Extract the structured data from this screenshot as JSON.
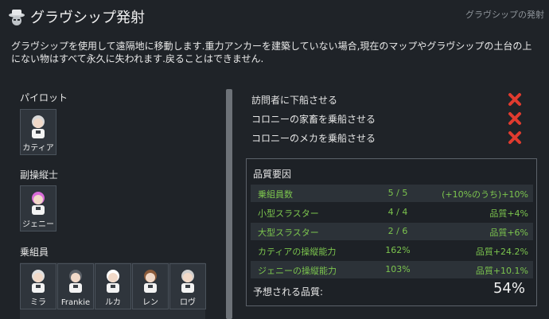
{
  "header": {
    "title": "グラヴシップ発射",
    "subtitle": "グラヴシップの発射"
  },
  "description": "グラヴシップを使用して遠隔地に移動します.重力アンカーを建築していない場合,現在のマップやグラヴシップの土台の上にない物はすべて永久に失われます.戻ることはできません.",
  "pilot": {
    "label": "パイロット",
    "members": [
      {
        "name": "カティア",
        "hair": "#d9d9d9"
      }
    ]
  },
  "copilot": {
    "label": "副操縦士",
    "members": [
      {
        "name": "ジェニー",
        "hair": "#d86bd8"
      }
    ]
  },
  "crew": {
    "label": "乗組員",
    "members": [
      {
        "name": "ミラ",
        "hair": "#e0e0e0"
      },
      {
        "name": "Frankie",
        "hair": "#5a5f66"
      },
      {
        "name": "ルカ",
        "hair": "#ffffff"
      },
      {
        "name": "レン",
        "hair": "#8a5a3a"
      },
      {
        "name": "ロヴ",
        "hair": "#cfcfcf"
      }
    ]
  },
  "conditions": [
    {
      "label": "訪問者に下船させる",
      "icon": "red-x-icon"
    },
    {
      "label": "コロニーの家畜を乗船させる",
      "icon": "red-x-icon"
    },
    {
      "label": "コロニーのメカを乗船させる",
      "icon": "red-x-icon"
    }
  ],
  "quality": {
    "title": "品質要因",
    "rows": [
      {
        "factor": "乗組員数",
        "value": "5 / 5",
        "effect": "(+10%のうち)+10%"
      },
      {
        "factor": "小型スラスター",
        "value": "4 / 4",
        "effect": "品質+4%"
      },
      {
        "factor": "大型スラスター",
        "value": "2 / 6",
        "effect": "品質+6%"
      },
      {
        "factor": "カティアの操縦能力",
        "value": "162%",
        "effect": "品質+24.2%"
      },
      {
        "factor": "ジェニーの操縦能力",
        "value": "103%",
        "effect": "品質+10.1%"
      }
    ],
    "expected_label": "予想される品質:",
    "expected_value": "54%"
  },
  "colors": {
    "background": "#1f2328",
    "factor_text": "#7cc54e",
    "x_icon": "#e03b2f"
  }
}
